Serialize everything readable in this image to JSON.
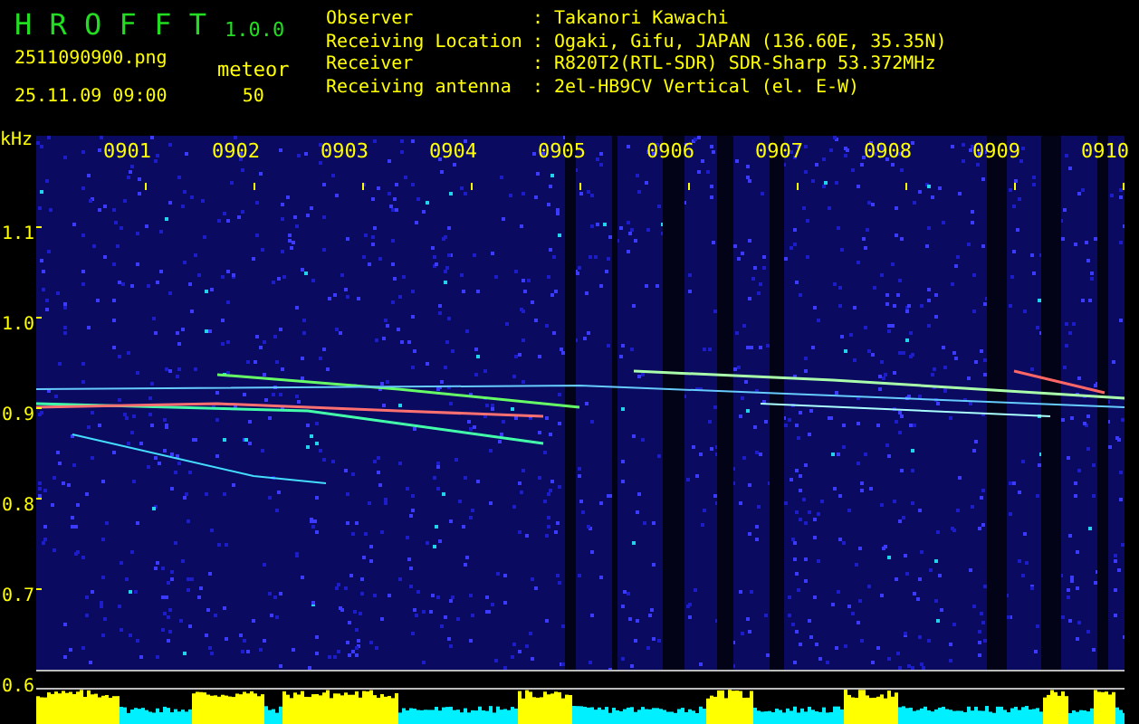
{
  "app": {
    "name": "H R O F F T",
    "version": "1.0.0"
  },
  "file": {
    "name": "2511090900.png",
    "datetime": "25.11.09 09:00"
  },
  "meteor": {
    "label": "meteor",
    "count": "50"
  },
  "station": [
    {
      "label": "Observer",
      "separator": ":",
      "value": "Takanori Kawachi"
    },
    {
      "label": "Receiving Location",
      "separator": ":",
      "value": "Ogaki, Gifu, JAPAN (136.60E, 35.35N)"
    },
    {
      "label": "Receiver",
      "separator": ":",
      "value": "R820T2(RTL-SDR) SDR-Sharp 53.372MHz"
    },
    {
      "label": "Receiving antenna",
      "separator": ":",
      "value": "2el-HB9CV Vertical (el. E-W)"
    }
  ],
  "spectrogram": {
    "unit": "kHz",
    "freq_labels": [
      "1.1",
      "1.0",
      "0.9",
      "0.8",
      "0.7",
      "0.6"
    ],
    "time_labels": [
      "0901",
      "0902",
      "0903",
      "0904",
      "0905",
      "0906",
      "0907",
      "0908",
      "0909",
      "0910"
    ]
  }
}
